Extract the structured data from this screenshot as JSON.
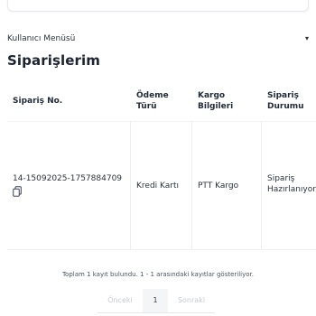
{
  "header": {
    "user_menu_label": "Kullanıcı Menüsü",
    "chevron_icon": "chevron-down-icon"
  },
  "page": {
    "title": "Siparişlerim"
  },
  "table": {
    "columns": [
      {
        "line1": "Sipariş No.",
        "line2": ""
      },
      {
        "line1": "Ödeme",
        "line2": "Türü"
      },
      {
        "line1": "Kargo",
        "line2": "Bilgileri"
      },
      {
        "line1": "Sipariş",
        "line2": "Durumu"
      }
    ],
    "rows": [
      {
        "order_no": "14-15092025-1757884709",
        "payment_type": "Kredi Kartı",
        "cargo": "PTT Kargo",
        "status_line1": "Sipariş",
        "status_line2": "Hazırlanıyor",
        "copy_icon": "copy-icon"
      }
    ]
  },
  "footer": {
    "summary": "Toplam 1 kayıt bulundu. 1 - 1 arasındaki kayıtlar gösteriliyor.",
    "pagination": {
      "prev": "Önceki",
      "current": "1",
      "next": "Sonraki"
    }
  }
}
